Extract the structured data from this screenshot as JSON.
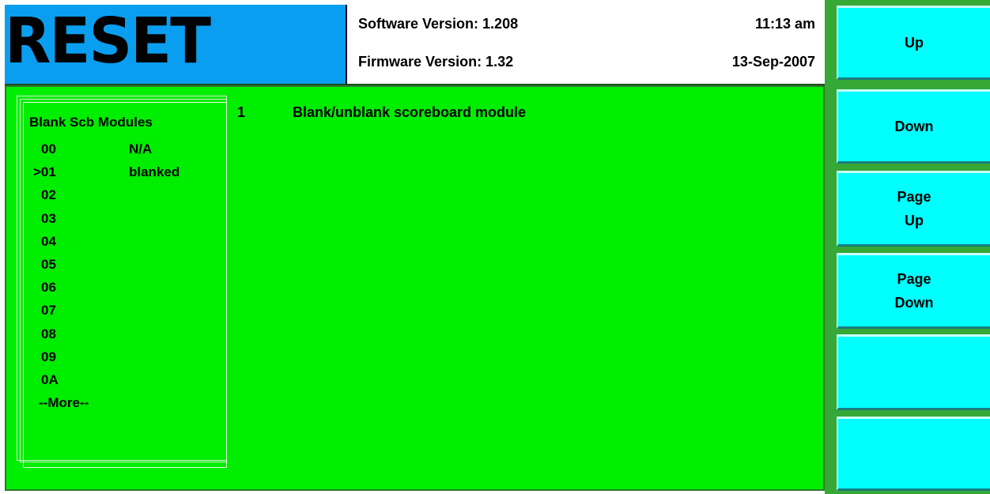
{
  "header": {
    "title": "RESET",
    "software_version": "Software Version: 1.208",
    "firmware_version": "Firmware Version: 1.32",
    "time": "11:13 am",
    "date": "13-Sep-2007"
  },
  "colors": {
    "title_bg": "#0a9ef0",
    "main_bg": "#00ee00",
    "button_bg": "#00ffff",
    "button_column_bg": "#36a836"
  },
  "module_list": {
    "header": "Blank Scb Modules",
    "rows": [
      {
        "code": "00",
        "status": "N/A"
      },
      {
        "code": ">01",
        "status": "blanked"
      },
      {
        "code": "02",
        "status": ""
      },
      {
        "code": "03",
        "status": ""
      },
      {
        "code": "04",
        "status": ""
      },
      {
        "code": "05",
        "status": ""
      },
      {
        "code": "06",
        "status": ""
      },
      {
        "code": "07",
        "status": ""
      },
      {
        "code": "08",
        "status": ""
      },
      {
        "code": "09",
        "status": ""
      },
      {
        "code": "0A",
        "status": ""
      }
    ],
    "more": "--More--"
  },
  "menu_item": {
    "number": "1",
    "description": "Blank/unblank scoreboard module"
  },
  "buttons": [
    {
      "label": "Up"
    },
    {
      "label": "Down"
    },
    {
      "label": "Page\nUp"
    },
    {
      "label": "Page\nDown"
    },
    {
      "label": ""
    },
    {
      "label": ""
    }
  ]
}
